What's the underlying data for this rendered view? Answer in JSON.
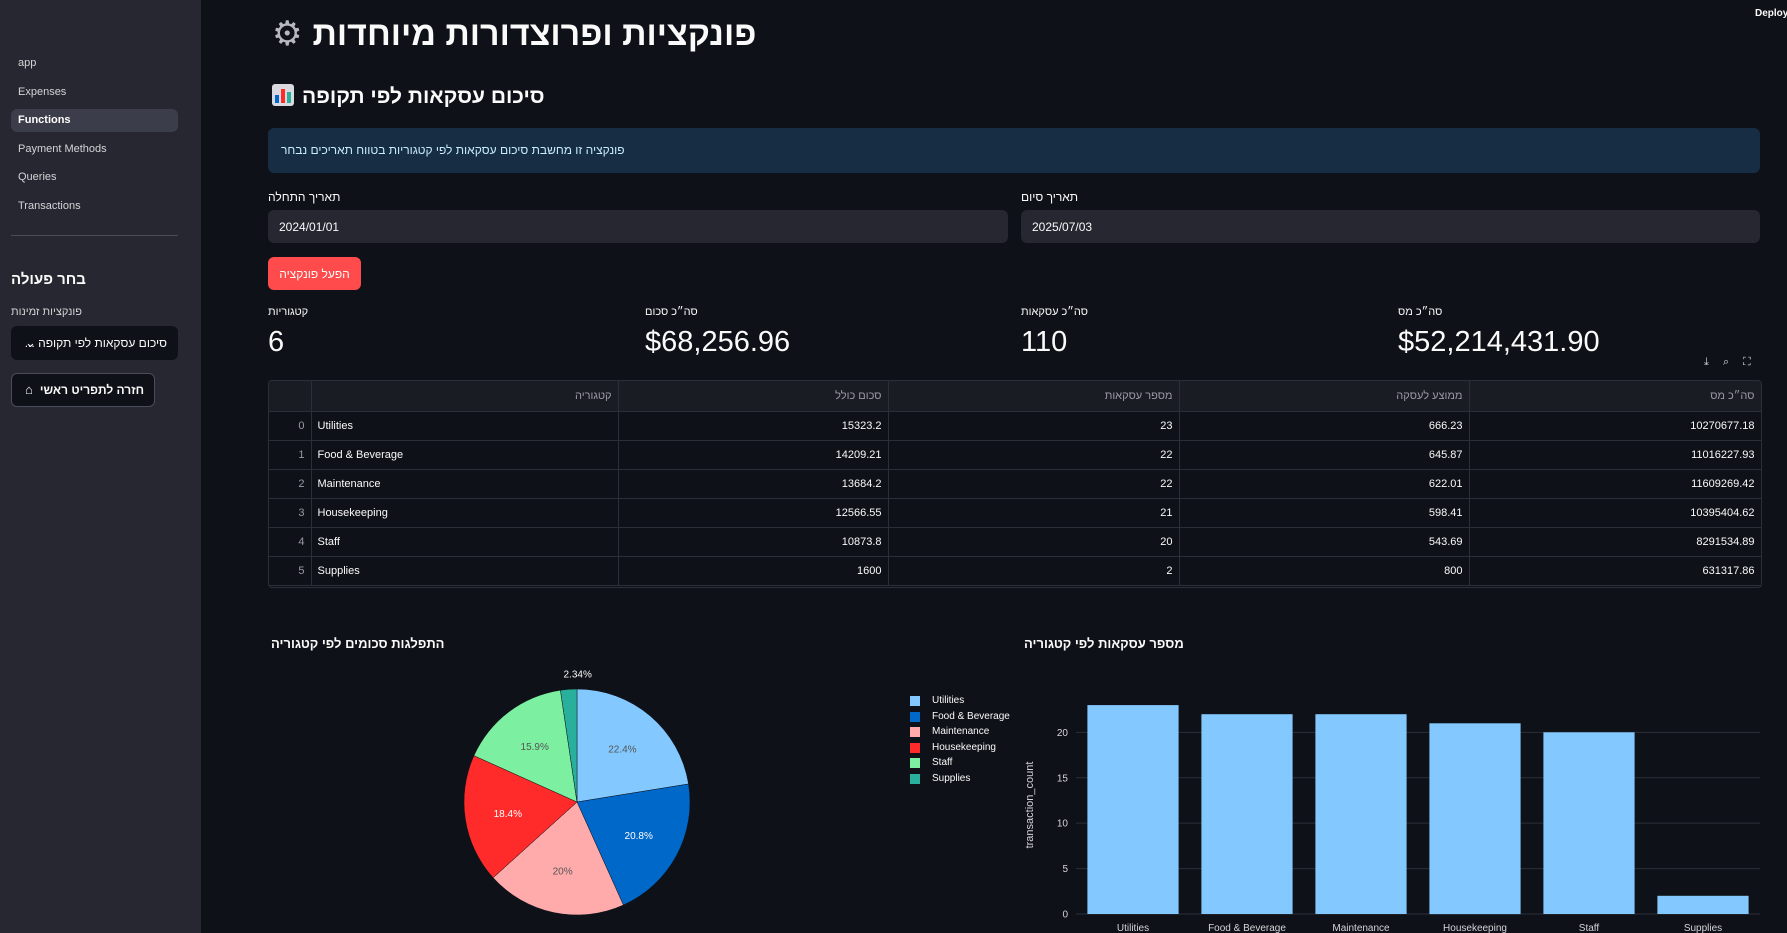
{
  "header": {
    "deploy_label": "Deploy"
  },
  "sidebar": {
    "nav": [
      {
        "label": "app",
        "active": false
      },
      {
        "label": "Expenses",
        "active": false
      },
      {
        "label": "Functions",
        "active": true
      },
      {
        "label": "Payment Methods",
        "active": false
      },
      {
        "label": "Queries",
        "active": false
      },
      {
        "label": "Transactions",
        "active": false
      }
    ],
    "heading": "בחר פעולה",
    "select_label": "פונקציות זמינות",
    "select_value": "סיכום עסקאות לפי תקופה ...",
    "back_button": "חזרה לתפריט ראשי",
    "chevron_icon": "chevron-down-icon",
    "home_icon": "house-icon"
  },
  "main": {
    "title": "פונקציות ופרוצדורות מיוחדות",
    "title_icon": "gear-icon",
    "subtitle": "סיכום עסקאות לפי תקופה",
    "subtitle_icon": "bar-chart-icon",
    "info": "פונקציה זו מחשבת סיכום עסקאות לפי קטגוריות בטווח תאריכים נבחר",
    "start_label": "תאריך התחלה",
    "start_value": "2024/01/01",
    "end_label": "תאריך סיום",
    "end_value": "2025/07/03",
    "run_button": "הפעל פונקציה",
    "metrics": [
      {
        "label": "קטגוריות",
        "value": "6"
      },
      {
        "label": "סה״כ סכום",
        "value": "$68,256.96"
      },
      {
        "label": "סה״כ עסקאות",
        "value": "110"
      },
      {
        "label": "סה״כ מס",
        "value": "$52,214,431.90"
      }
    ],
    "table_toolbar_icons": [
      "download-icon",
      "search-icon",
      "fullscreen-icon"
    ]
  },
  "table": {
    "headers": [
      "",
      "קטגוריה",
      "סכום כולל",
      "מספר עסקאות",
      "ממוצע לעסקה",
      "סה״כ מס"
    ],
    "rows": [
      [
        "0",
        "Utilities",
        "15323.2",
        "23",
        "666.23",
        "10270677.18"
      ],
      [
        "1",
        "Food & Beverage",
        "14209.21",
        "22",
        "645.87",
        "11016227.93"
      ],
      [
        "2",
        "Maintenance",
        "13684.2",
        "22",
        "622.01",
        "11609269.42"
      ],
      [
        "3",
        "Housekeeping",
        "12566.55",
        "21",
        "598.41",
        "10395404.62"
      ],
      [
        "4",
        "Staff",
        "10873.8",
        "20",
        "543.69",
        "8291534.89"
      ],
      [
        "5",
        "Supplies",
        "1600",
        "2",
        "800",
        "631317.86"
      ]
    ]
  },
  "chart_data": [
    {
      "type": "pie",
      "title": "התפלגות סכומים לפי קטגוריה",
      "categories": [
        "Utilities",
        "Food & Beverage",
        "Maintenance",
        "Housekeeping",
        "Staff",
        "Supplies"
      ],
      "values": [
        15323.2,
        14209.21,
        13684.2,
        12566.55,
        10873.8,
        1600
      ],
      "slice_labels": [
        "22.4%",
        "20.8%",
        "20%",
        "18.4%",
        "15.9%",
        "2.34%"
      ],
      "colors": [
        "#83c9ff",
        "#0068c9",
        "#ffabab",
        "#ff2b2b",
        "#7defa1",
        "#29b09d"
      ],
      "legend": "right"
    },
    {
      "type": "bar",
      "title": "מספר עסקאות לפי קטגוריה",
      "categories": [
        "Utilities",
        "Food & Beverage",
        "Maintenance",
        "Housekeeping",
        "Staff",
        "Supplies"
      ],
      "values": [
        23,
        22,
        22,
        21,
        20,
        2
      ],
      "ylabel": "transaction_count",
      "xlabel": "",
      "ylim": [
        0,
        24
      ],
      "yticks": [
        0,
        5,
        10,
        15,
        20
      ],
      "grid": true,
      "color": "#83c9ff"
    }
  ]
}
